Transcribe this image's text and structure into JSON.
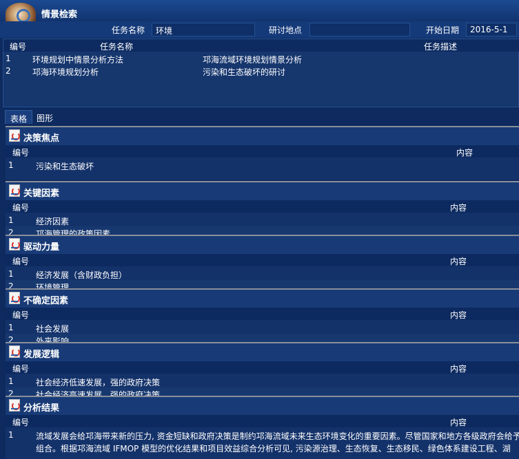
{
  "app": {
    "title": "情景检索",
    "icon": "app-logo-icon"
  },
  "filters": {
    "task_name_label": "任务名称",
    "task_name_value": "环境",
    "location_label": "研讨地点",
    "location_value": "",
    "start_date_label": "开始日期",
    "start_date_value": "2016-5-1"
  },
  "task_table": {
    "columns": [
      "编号",
      "任务名称",
      "任务描述"
    ],
    "rows": [
      [
        "1",
        "环境规划中情景分析方法",
        "邛海流域环境规划情景分析"
      ],
      [
        "2",
        "邛海环境规划分析",
        "污染和生态破坏的研讨"
      ]
    ]
  },
  "tabs": [
    {
      "label": "表格"
    },
    {
      "label": "图形"
    }
  ],
  "sections": [
    {
      "title": "决策焦点",
      "icon": "java-icon",
      "col_id": "编号",
      "col_content": "内容",
      "rows": [
        [
          "1",
          "污染和生态破坏"
        ]
      ]
    },
    {
      "title": "关键因素",
      "icon": "java-icon",
      "col_id": "编号",
      "col_content": "内容",
      "rows": [
        [
          "1",
          "经济因素"
        ],
        [
          "2",
          "邛海管理的政策因素"
        ]
      ]
    },
    {
      "title": "驱动力量",
      "icon": "java-icon",
      "col_id": "编号",
      "col_content": "内容",
      "rows": [
        [
          "1",
          "经济发展（含财政负担）"
        ],
        [
          "2",
          "环境管理"
        ]
      ]
    },
    {
      "title": "不确定因素",
      "icon": "java-icon",
      "col_id": "编号",
      "col_content": "内容",
      "rows": [
        [
          "1",
          "社会发展"
        ],
        [
          "2",
          "外来影响"
        ]
      ]
    },
    {
      "title": "发展逻辑",
      "icon": "java-icon",
      "col_id": "编号",
      "col_content": "内容",
      "rows": [
        [
          "1",
          "社会经济低速发展，强的政府决策"
        ],
        [
          "2",
          "社会经济高速发展，强的政府决策"
        ]
      ]
    },
    {
      "title": "分析结果",
      "icon": "java-icon",
      "col_id": "编号",
      "col_content": "内容",
      "rows": [
        [
          "1",
          "流域发展会给邛海带来新的压力, 资金短缺和政府决策是制约邛海流域未来生态环境变化的重要因素。尽管国家和地方各级政府会给予"
        ],
        [
          "",
          "组合。根据邛海流域 IFMOP 模型的优化结果和项目效益综合分析可见, 污染源治理、生态恢复、生态移民、绿色体系建设工程、湖"
        ]
      ]
    }
  ]
}
